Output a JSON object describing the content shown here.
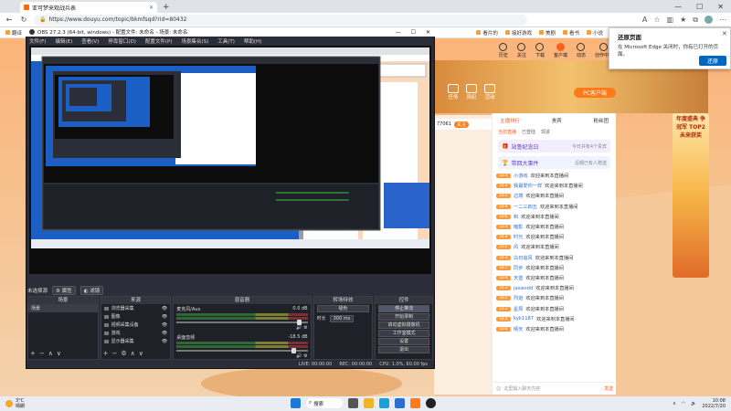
{
  "browser": {
    "tab_title": "亚可梦来观战兵表",
    "url": "https://www.douyu.com/topic/bkmfsqd?rid=80432",
    "favorites": [
      "翻译",
      "扇",
      "美菜",
      "打笑",
      "知乎",
      "诗",
      "直播",
      "游戏",
      "在线",
      "对",
      "全部",
      "斗",
      "小说"
    ],
    "favorites_right": [
      "看片的",
      "接好游戏",
      "美剧",
      "看书",
      "小说"
    ]
  },
  "douyu": {
    "header_items": [
      "历史",
      "关注",
      "下载",
      "客户端",
      "动态",
      "创作中心"
    ],
    "hero_buttons": [
      "任务",
      "风纪",
      "活动"
    ],
    "pc_button": "PC客户端",
    "chat_tabs": [
      "主播排行",
      "贵宾",
      "粉丝团"
    ],
    "chat_row1": [
      "当前直播",
      "已登陆",
      "现进"
    ],
    "gift_banner": "站鲁纪念日",
    "gift_banner_sub": "今日共有4个贵宾",
    "gift_banner2": "带回大事件",
    "gift_banner2_sub": "近期已有人赠送",
    "welcome_text": "欢迎来到本直播间",
    "chat_messages": [
      {
        "level": "LV.3",
        "name": "小游戏"
      },
      {
        "level": "LV.4",
        "name": "我最爱你一样"
      },
      {
        "level": "LV.3",
        "name": "边境"
      },
      {
        "level": "LV.9",
        "name": "一二三四五"
      },
      {
        "level": "LV.6",
        "name": "和"
      },
      {
        "level": "LV.3",
        "name": "暗影"
      },
      {
        "level": "LV.4",
        "name": "时光"
      },
      {
        "level": "LV.2",
        "name": "风"
      },
      {
        "level": "LV.3",
        "name": "白日追风"
      },
      {
        "level": "LV.7",
        "name": "同步"
      },
      {
        "level": "LV.4",
        "name": "天蓝"
      },
      {
        "level": "LV.3",
        "name": "jasiesdd"
      },
      {
        "level": "LV.5",
        "name": "烈焰"
      },
      {
        "level": "LV.2",
        "name": "星辰"
      },
      {
        "level": "LV.3",
        "name": "kyk1187"
      },
      {
        "level": "LV.6",
        "name": "晴天"
      }
    ],
    "chat_input_hint": "这里输入聊天内容",
    "chat_send": "发送",
    "ad_text": "年度盛典 争冠军 TOP2 未来获奖"
  },
  "notification": {
    "title": "还原页面",
    "body": "在 Microsoft Edge 关闭时，你有已打开的页面。",
    "button": "还原"
  },
  "obs": {
    "title": "OBS 27.2.3 (64-bit, windows) - 配置文件: 未命名 - 场景: 未命名",
    "menu": [
      "文件(F)",
      "编辑(E)",
      "查看(V)",
      "停靠窗口(D)",
      "配置文件(P)",
      "场景集合(S)",
      "工具(T)",
      "帮助(H)"
    ],
    "preview_controls": [
      "未选择源",
      "属性",
      "滤镜"
    ],
    "dock_titles": [
      "场景",
      "来源",
      "混音器",
      "转场特效",
      "控件"
    ],
    "scenes": [
      "场景"
    ],
    "sources": [
      "浏览器采集",
      "图像",
      "视频采集设备",
      "游戏",
      "显示器采集"
    ],
    "mixer_channels": [
      {
        "name": "麦克风/Aux",
        "db": "0.0 dB"
      },
      {
        "name": "桌面音频",
        "db": "-18.5 dB"
      }
    ],
    "transition": {
      "type": "褪色",
      "duration_label": "时长",
      "duration": "300 ms"
    },
    "controls": [
      "停止推流",
      "开始录制",
      "启动虚拟摄像机",
      "工作室模式",
      "设置",
      "退出"
    ],
    "status": {
      "live": "LIVE: 00:00:00",
      "rec": "REC: 00:00:00",
      "cpu": "CPU: 1.0%, 60.00 fps"
    }
  },
  "taskbar": {
    "temp": "3°C",
    "weather": "晴朗",
    "search": "搜索",
    "time": "10:08",
    "date": "2022/7/20"
  }
}
